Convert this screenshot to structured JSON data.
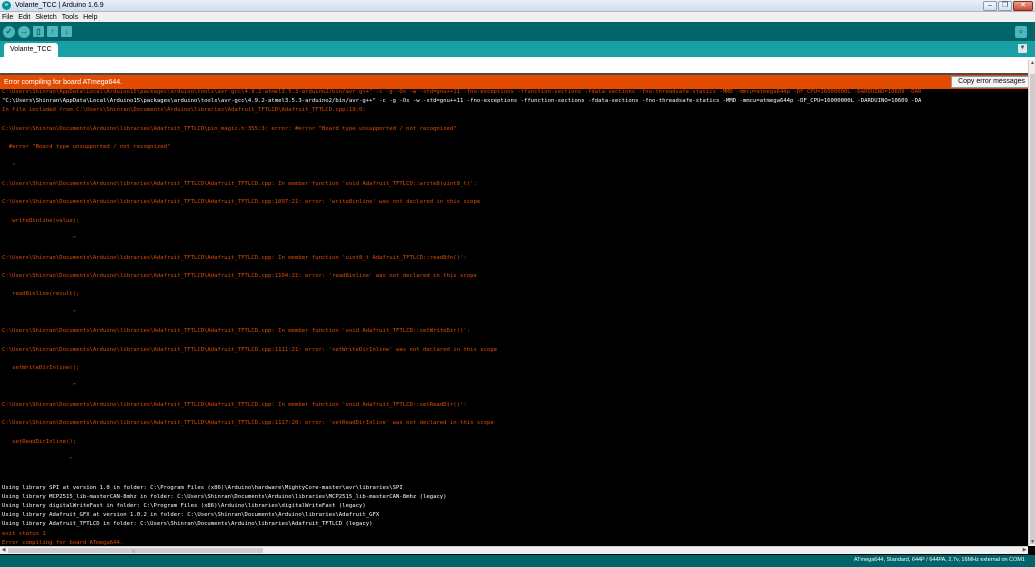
{
  "window": {
    "title": "Volante_TCC | Arduino 1.6.9",
    "logo": "arduino-logo",
    "controls": [
      "minimize",
      "maximize",
      "close"
    ]
  },
  "menu": [
    "File",
    "Edit",
    "Sketch",
    "Tools",
    "Help"
  ],
  "toolbar": {
    "buttons": [
      {
        "name": "verify-icon",
        "glyph": "✓"
      },
      {
        "name": "upload-icon",
        "glyph": "→"
      },
      {
        "name": "new-icon",
        "glyph": "▯"
      },
      {
        "name": "open-icon",
        "glyph": "↑"
      },
      {
        "name": "save-icon",
        "glyph": "↓"
      }
    ],
    "serial_glyph": "⌕"
  },
  "tabs": {
    "active": "Volante_TCC",
    "menu_glyph": "▼"
  },
  "error_bar": {
    "message": "Error compiling for board ATmega644.",
    "copy_label": "Copy error messages"
  },
  "console_lines": [
    {
      "t": "err",
      "text": "C:\\Users\\Shinran\\AppData\\Local\\Arduino15\\packages\\arduino\\tools\\avr-gcc\\4.9.2-atmel3.5.3-arduino2/bin/avr-g++\" -c -g -Os -w -std=gnu++11 -fno-exceptions -ffunction-sections -fdata-sections -fno-threadsafe-statics -MMD -mmcu=atmega644p -DF_CPU=16000000L -DARDUINO=10609 -DAR"
    },
    {
      "t": "info",
      "text": "\"C:\\Users\\Shinran\\AppData\\Local\\Arduino15\\packages\\arduino\\tools\\avr-gcc\\4.9.2-atmel3.5.3-arduino2/bin/avr-g++\" -c -g -Os -w -std=gnu++11 -fno-exceptions -ffunction-sections -fdata-sections -fno-threadsafe-statics -MMD -mmcu=atmega644p -DF_CPU=16000000L -DARDUINO=10609 -DA"
    },
    {
      "t": "err",
      "text": "In file included from C:\\Users\\Shinran\\Documents\\Arduino\\libraries\\Adafruit_TFTLCD\\Adafruit_TFTLCD.cpp:19:0:"
    },
    {
      "t": "err",
      "text": ""
    },
    {
      "t": "err",
      "text": "C:\\Users\\Shinran\\Documents\\Arduino\\libraries\\Adafruit_TFTLCD\\pin_magic.h:355:3: error: #error \"Board type unsupported / not recognized\""
    },
    {
      "t": "err",
      "text": ""
    },
    {
      "t": "err",
      "text": "  #error \"Board type unsupported / not recognized\""
    },
    {
      "t": "err",
      "text": ""
    },
    {
      "t": "err",
      "text": "   ^"
    },
    {
      "t": "err",
      "text": ""
    },
    {
      "t": "err",
      "text": "C:\\Users\\Shinran\\Documents\\Arduino\\libraries\\Adafruit_TFTLCD\\Adafruit_TFTLCD.cpp: In member function 'void Adafruit_TFTLCD::write8(uint8_t)':"
    },
    {
      "t": "err",
      "text": ""
    },
    {
      "t": "err",
      "text": "C:\\Users\\Shinran\\Documents\\Arduino\\libraries\\Adafruit_TFTLCD\\Adafruit_TFTLCD.cpp:1097:21: error: 'write8inline' was not declared in this scope"
    },
    {
      "t": "err",
      "text": ""
    },
    {
      "t": "err",
      "text": "   write8inline(value);"
    },
    {
      "t": "err",
      "text": ""
    },
    {
      "t": "err",
      "text": "                     ^"
    },
    {
      "t": "err",
      "text": ""
    },
    {
      "t": "err",
      "text": "C:\\Users\\Shinran\\Documents\\Arduino\\libraries\\Adafruit_TFTLCD\\Adafruit_TFTLCD.cpp: In member function 'uint8_t Adafruit_TFTLCD::read8fn()':"
    },
    {
      "t": "err",
      "text": ""
    },
    {
      "t": "err",
      "text": "C:\\Users\\Shinran\\Documents\\Arduino\\libraries\\Adafruit_TFTLCD\\Adafruit_TFTLCD.cpp:1104:21: error: 'read8inline' was not declared in this scope"
    },
    {
      "t": "err",
      "text": ""
    },
    {
      "t": "err",
      "text": "   read8inline(result);"
    },
    {
      "t": "err",
      "text": ""
    },
    {
      "t": "err",
      "text": "                     ^"
    },
    {
      "t": "err",
      "text": ""
    },
    {
      "t": "err",
      "text": "C:\\Users\\Shinran\\Documents\\Arduino\\libraries\\Adafruit_TFTLCD\\Adafruit_TFTLCD.cpp: In member function 'void Adafruit_TFTLCD::setWriteDir()':"
    },
    {
      "t": "err",
      "text": ""
    },
    {
      "t": "err",
      "text": "C:\\Users\\Shinran\\Documents\\Arduino\\libraries\\Adafruit_TFTLCD\\Adafruit_TFTLCD.cpp:1111:21: error: 'setWriteDirInline' was not declared in this scope"
    },
    {
      "t": "err",
      "text": ""
    },
    {
      "t": "err",
      "text": "   setWriteDirInline();"
    },
    {
      "t": "err",
      "text": ""
    },
    {
      "t": "err",
      "text": "                     ^"
    },
    {
      "t": "err",
      "text": ""
    },
    {
      "t": "err",
      "text": "C:\\Users\\Shinran\\Documents\\Arduino\\libraries\\Adafruit_TFTLCD\\Adafruit_TFTLCD.cpp: In member function 'void Adafruit_TFTLCD::setReadDir()':"
    },
    {
      "t": "err",
      "text": ""
    },
    {
      "t": "err",
      "text": "C:\\Users\\Shinran\\Documents\\Arduino\\libraries\\Adafruit_TFTLCD\\Adafruit_TFTLCD.cpp:1117:20: error: 'setReadDirInline' was not declared in this scope"
    },
    {
      "t": "err",
      "text": ""
    },
    {
      "t": "err",
      "text": "   setReadDirInline();"
    },
    {
      "t": "err",
      "text": ""
    },
    {
      "t": "err",
      "text": "                    ^"
    },
    {
      "t": "err",
      "text": ""
    },
    {
      "t": "err",
      "text": ""
    },
    {
      "t": "info",
      "text": "Using library SPI at version 1.0 in folder: C:\\Program Files (x86)\\Arduino\\hardware\\MightyCore-master\\avr\\libraries\\SPI"
    },
    {
      "t": "info",
      "text": "Using library MCP2515_lib-masterCAN-8mhz in folder: C:\\Users\\Shinran\\Documents\\Arduino\\libraries\\MCP2515_lib-masterCAN-8mhz (legacy)"
    },
    {
      "t": "info",
      "text": "Using library digitalWriteFast in folder: C:\\Program Files (x86)\\Arduino\\libraries\\digitalWriteFast (legacy)"
    },
    {
      "t": "info",
      "text": "Using library Adafruit_GFX at version 1.0.2 in folder: C:\\Users\\Shinran\\Documents\\Arduino\\libraries\\Adafruit_GFX"
    },
    {
      "t": "info",
      "text": "Using library Adafruit_TFTLCD in folder: C:\\Users\\Shinran\\Documents\\Arduino\\libraries\\Adafruit_TFTLCD (legacy)"
    },
    {
      "t": "err",
      "text": "exit status 1"
    },
    {
      "t": "err",
      "text": "Error compiling for board ATmega644."
    }
  ],
  "status_bar": {
    "text": "ATmega644, Standard, 644P / 644PA, 2.7v, 16MHz external on COM1"
  },
  "colors": {
    "teal_dark": "#006468",
    "teal_tab": "#17a1a5",
    "error_orange": "#e34c00",
    "console_bg": "#000000"
  }
}
